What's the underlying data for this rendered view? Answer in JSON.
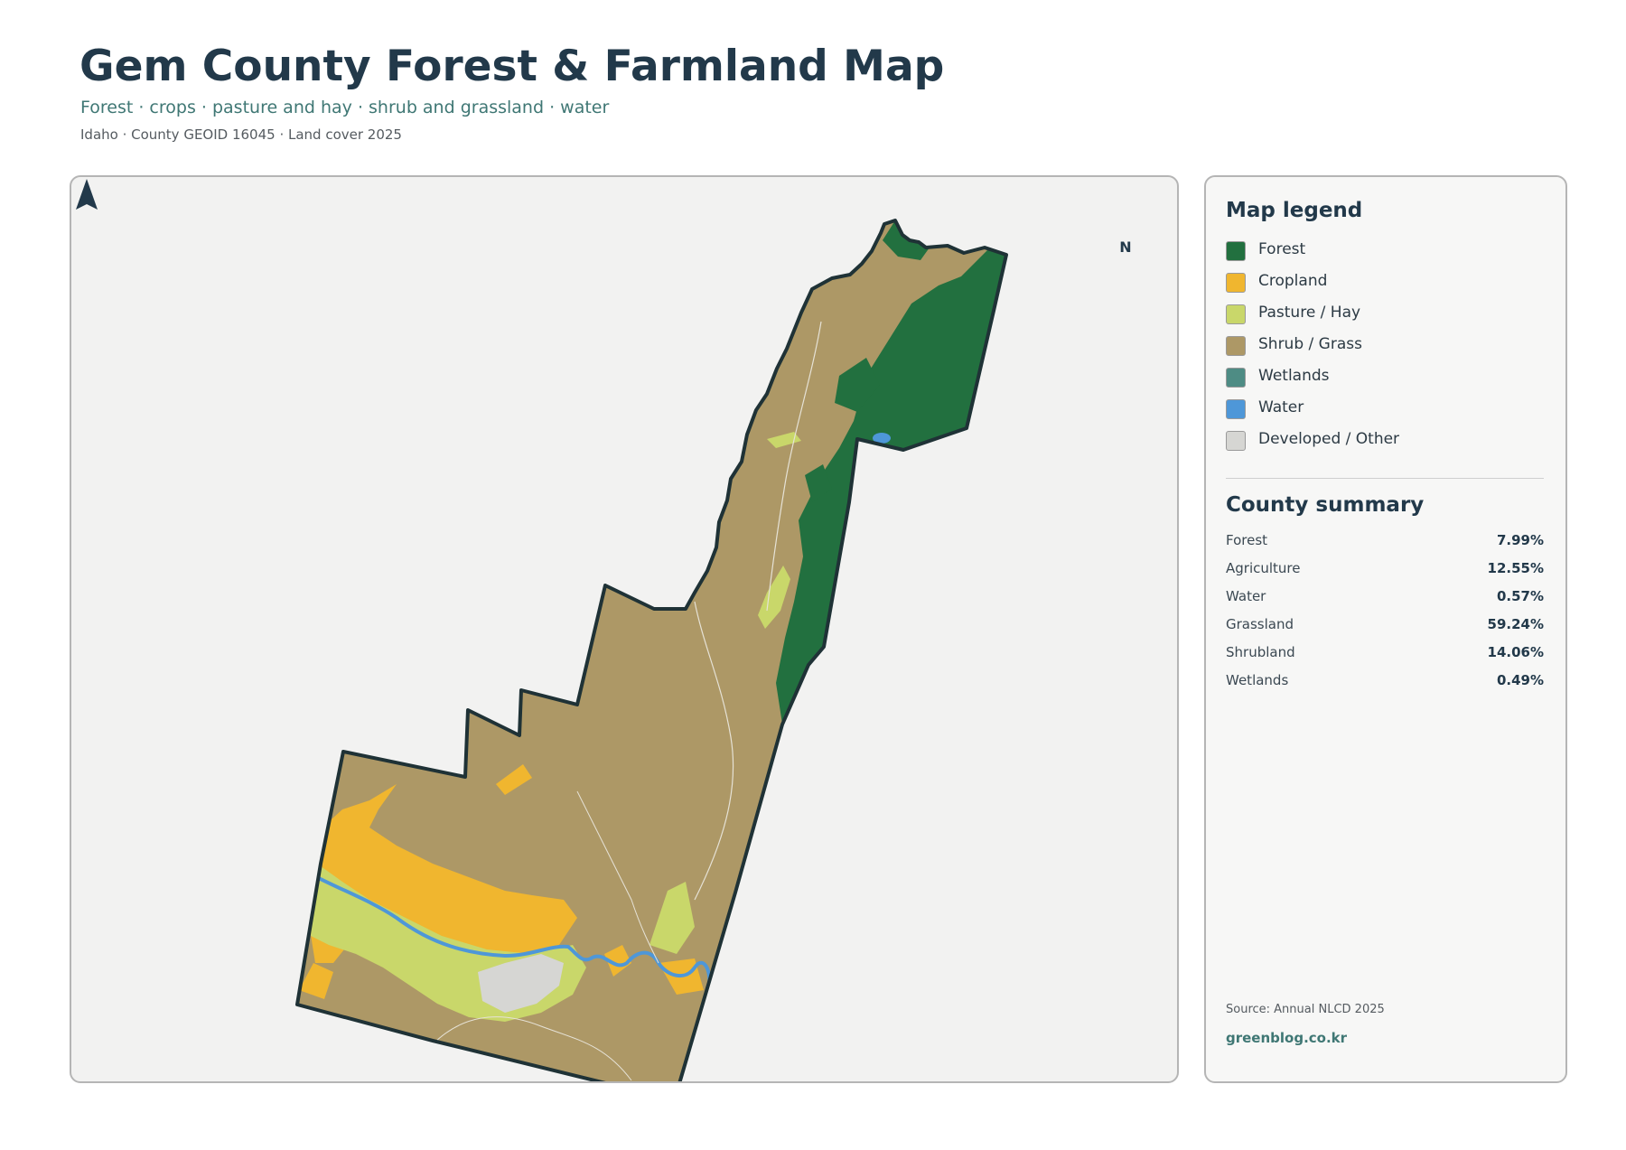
{
  "header": {
    "title": "Gem County Forest & Farmland Map",
    "subtitle": "Forest · crops · pasture and hay · shrub and grassland · water",
    "meta": "Idaho · County GEOID 16045 · Land cover 2025"
  },
  "map": {
    "north_label": "N",
    "colors": {
      "forest": "#22703f",
      "cropland": "#f0b62f",
      "pasture": "#c9d76a",
      "shrub_grass": "#ad9866",
      "wetlands": "#4e8c84",
      "water": "#4e97d8",
      "developed": "#d6d6d3",
      "boundary": "#1f3236",
      "background": "#f2f2f1"
    }
  },
  "legend": {
    "heading": "Map legend",
    "items": [
      {
        "label": "Forest",
        "color": "#22703f"
      },
      {
        "label": "Cropland",
        "color": "#f0b62f"
      },
      {
        "label": "Pasture / Hay",
        "color": "#c9d76a"
      },
      {
        "label": "Shrub / Grass",
        "color": "#ad9866"
      },
      {
        "label": "Wetlands",
        "color": "#4e8c84"
      },
      {
        "label": "Water",
        "color": "#4e97d8"
      },
      {
        "label": "Developed / Other",
        "color": "#d6d6d3"
      }
    ]
  },
  "summary": {
    "heading": "County summary",
    "rows": [
      {
        "label": "Forest",
        "value": "7.99%"
      },
      {
        "label": "Agriculture",
        "value": "12.55%"
      },
      {
        "label": "Water",
        "value": "0.57%"
      },
      {
        "label": "Grassland",
        "value": "59.24%"
      },
      {
        "label": "Shrubland",
        "value": "14.06%"
      },
      {
        "label": "Wetlands",
        "value": "0.49%"
      }
    ]
  },
  "footer": {
    "source": "Source: Annual NLCD 2025",
    "site": "greenblog.co.kr"
  }
}
